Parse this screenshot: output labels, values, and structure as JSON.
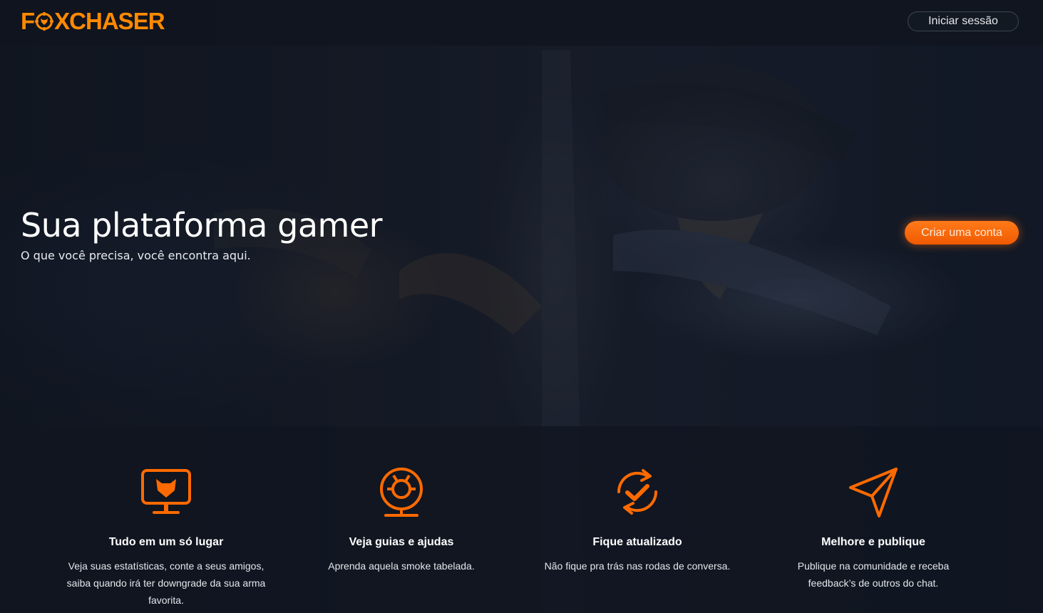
{
  "brand": {
    "logo_text": [
      "F",
      "XCHASER"
    ],
    "accent_color": "#ff8a00"
  },
  "header": {
    "login_label": "Iniciar sessão"
  },
  "hero": {
    "title": "Sua plataforma gamer",
    "subtitle": "O que você precisa, você encontra aqui.",
    "cta_label": "Criar uma conta",
    "cta_color": "#ff6a00"
  },
  "features": [
    {
      "icon": "monitor-fox-icon",
      "title": "Tudo em um só lugar",
      "description": "Veja suas estatísticas, conte a seus amigos, saiba quando irá ter downgrade da sua arma favorita."
    },
    {
      "icon": "lifebuoy-icon",
      "title": "Veja guias e ajudas",
      "description": "Aprenda aquela smoke tabelada."
    },
    {
      "icon": "refresh-check-icon",
      "title": "Fique atualizado",
      "description": "Não fique pra trás nas rodas de conversa."
    },
    {
      "icon": "paper-plane-icon",
      "title": "Melhore e publique",
      "description": "Publique na comunidade e receba feedback’s de outros do chat."
    }
  ]
}
